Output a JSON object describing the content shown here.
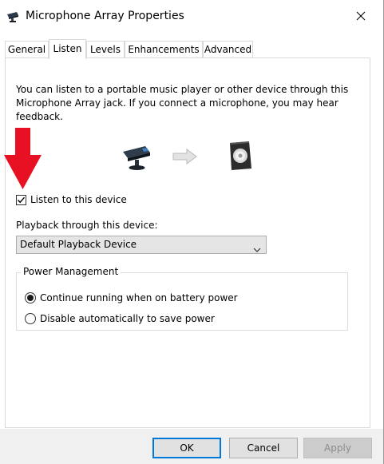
{
  "window": {
    "title": "Microphone Array Properties",
    "close_glyph": "✕"
  },
  "tabs": [
    {
      "label": "General",
      "active": false
    },
    {
      "label": "Listen",
      "active": true
    },
    {
      "label": "Levels",
      "active": false
    },
    {
      "label": "Enhancements",
      "active": false
    },
    {
      "label": "Advanced",
      "active": false
    }
  ],
  "listen": {
    "description_lines": [
      "You can listen to a portable music player or other device through this",
      "Microphone Array jack.  If you connect a microphone, you may hear",
      "feedback."
    ],
    "listen_checkbox_label": "Listen to this device",
    "listen_checked": true,
    "playback_label": "Playback through this device:",
    "playback_selected": "Default Playback Device",
    "power_group_title": "Power Management",
    "power_options": [
      {
        "label": "Continue running when on battery power",
        "selected": true
      },
      {
        "label": "Disable automatically to save power",
        "selected": false
      }
    ]
  },
  "buttons": {
    "ok": "OK",
    "cancel": "Cancel",
    "apply": "Apply"
  },
  "icons": {
    "title": "microphone-array-icon",
    "microphone": "microphone-device-icon",
    "arrow": "right-arrow-icon",
    "speaker": "speaker-icon",
    "annotation": "red-down-arrow-annotation",
    "dropdown": "chevron-down-icon"
  },
  "colors": {
    "accent": "#0078d7",
    "annotation_red": "#e81123",
    "button_face": "#e1e1e1",
    "dropdown_face": "#e5e5e5"
  }
}
